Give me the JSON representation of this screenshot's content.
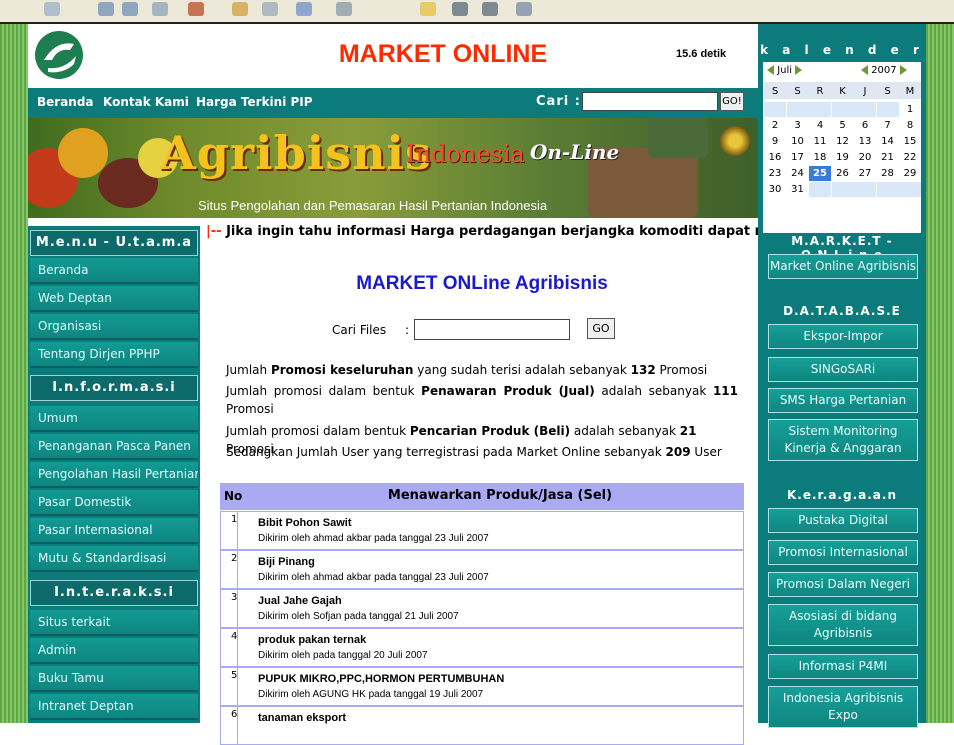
{
  "header": {
    "title": "MARKET ONLINE",
    "timer": "15.6 detik"
  },
  "nav": {
    "links": [
      "Beranda",
      "Kontak Kami",
      "Harga Terkini PIP"
    ],
    "search_label": "Cari :",
    "search_value": "",
    "go_label": "GO!"
  },
  "banner": {
    "title": "Agribisnis",
    "indonesia": "Indonesia",
    "online": "On-Line",
    "subtitle": "Situs Pengolahan dan Pemasaran Hasil Pertanian Indonesia"
  },
  "left_menu": {
    "sections": [
      {
        "title": "M.e.n.u - U.t.a.m.a",
        "items": [
          "Beranda",
          "Web Deptan",
          "Organisasi",
          "Tentang Dirjen PPHP"
        ]
      },
      {
        "title": "I.n.f.o.r.m.a.s.i",
        "items": [
          "Umum",
          "Penanganan Pasca Panen",
          "Pengolahan Hasil Pertanian",
          "Pasar Domestik",
          "Pasar Internasional",
          "Mutu & Standardisasi"
        ]
      },
      {
        "title": "I.n.t.e.r.a.k.s.i",
        "items": [
          "Situs terkait",
          "Admin",
          "Buku Tamu",
          "Intranet Deptan"
        ]
      }
    ]
  },
  "ticker": {
    "bar": "|--",
    "text": "Jika ingin tahu informasi Harga perdagangan berjangka komoditi dapat m"
  },
  "main": {
    "title": "MARKET ONLine Agribisnis",
    "cari_files_label": "Cari Files",
    "cari_files_colon": ":",
    "cari_files_value": "",
    "go_label": "GO",
    "stats": {
      "line1_a": "Jumlah ",
      "line1_b": "Promosi keseluruhan",
      "line1_c": " yang sudah terisi adalah sebanyak ",
      "line1_d": "132",
      "line1_e": " Promosi",
      "line2_a": "Jumlah promosi dalam bentuk ",
      "line2_b": "Penawaran Produk (Jual)",
      "line2_c": " adalah sebanyak ",
      "line2_d": "111",
      "line2_e": " Promosi",
      "line3_a": "Jumlah promosi dalam bentuk ",
      "line3_b": "Pencarian Produk (Beli)",
      "line3_c": " adalah sebanyak ",
      "line3_d": "21",
      "line3_e": " Promosi",
      "line4_a": "Sedangkan Jumlah User yang terregistrasi pada Market Online sebanyak ",
      "line4_b": "209",
      "line4_c": " User"
    }
  },
  "table": {
    "col_no": "No",
    "col_title": "Menawarkan Produk/Jasa (Sel)",
    "rows": [
      {
        "no": "1",
        "name": "Bibit Pohon Sawit",
        "meta": "Dikirim oleh ahmad akbar pada tanggal 23 Juli 2007"
      },
      {
        "no": "2",
        "name": "Biji Pinang",
        "meta": "Dikirim oleh ahmad akbar pada tanggal 23 Juli 2007"
      },
      {
        "no": "3",
        "name": "Jual Jahe Gajah",
        "meta": "Dikirim oleh Sofjan pada tanggal 21 Juli 2007"
      },
      {
        "no": "4",
        "name": "produk pakan ternak",
        "meta": "Dikirim oleh pada tanggal 20 Juli 2007"
      },
      {
        "no": "5",
        "name": "PUPUK MIKRO,PPC,HORMON PERTUMBUHAN",
        "meta": "Dikirim oleh AGUNG HK pada tanggal 19 Juli 2007"
      },
      {
        "no": "6",
        "name": "tanaman eksport",
        "meta": ""
      }
    ]
  },
  "calendar": {
    "title": "k a l e n d e r",
    "month": "Juli",
    "year": "2007",
    "days": [
      "S",
      "S",
      "R",
      "K",
      "J",
      "S",
      "M"
    ],
    "weeks": [
      [
        "",
        "",
        "",
        "",
        "",
        "",
        "1"
      ],
      [
        "2",
        "3",
        "4",
        "5",
        "6",
        "7",
        "8"
      ],
      [
        "9",
        "10",
        "11",
        "12",
        "13",
        "14",
        "15"
      ],
      [
        "16",
        "17",
        "18",
        "19",
        "20",
        "21",
        "22"
      ],
      [
        "23",
        "24",
        "25",
        "26",
        "27",
        "28",
        "29"
      ],
      [
        "30",
        "31",
        "",
        "",
        "",
        "",
        ""
      ]
    ],
    "today": "25"
  },
  "right_menu": {
    "market_head": "M.A.R.K.E.T - O.N.L.i.n.e",
    "market_items": [
      "Market Online Agribisnis"
    ],
    "database_head": "D.A.T.A.B.A.S.E",
    "database_items": [
      "Ekspor-Impor",
      "SINGoSARi",
      "SMS Harga Pertanian",
      "Sistem Monitoring Kinerja & Anggaran"
    ],
    "keragaan_head": "K.e.r.a.g.a.a.n",
    "keragaan_items": [
      "Pustaka Digital",
      "Promosi Internasional",
      "Promosi Dalam Negeri",
      "Asosiasi di bidang Agribisnis",
      "Informasi P4MI",
      "Indonesia Agribisnis Expo"
    ]
  },
  "colors": {
    "teal": "#0b7b7b",
    "title_red": "#ff2a00",
    "main_title_blue": "#1a1acc",
    "table_head": "#a9a9f4"
  }
}
